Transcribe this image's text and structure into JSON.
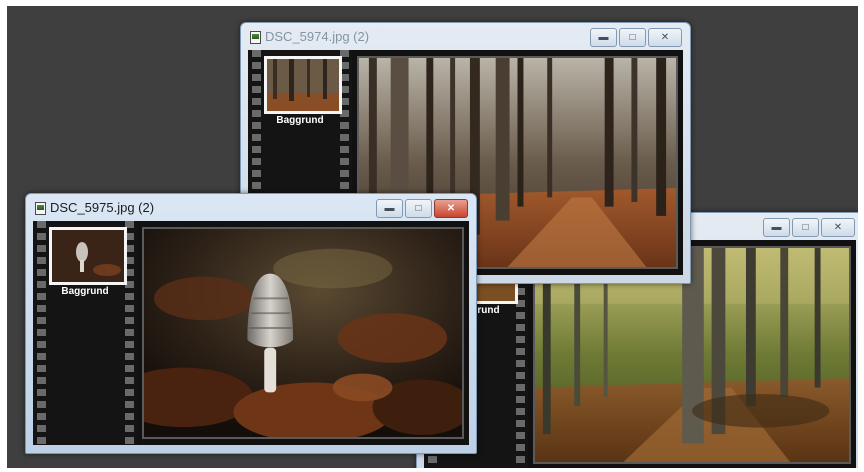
{
  "windows": {
    "back_right": {
      "title": "",
      "controls": {
        "minimize": "▬",
        "maximize": "□",
        "close": "✕"
      },
      "thumb_label": "Baggrund",
      "photo_icon": "forest-path-photo"
    },
    "top": {
      "title": "DSC_5974.jpg (2)",
      "controls": {
        "minimize": "▬",
        "maximize": "□",
        "close": "✕"
      },
      "thumb_label": "Baggrund",
      "photo_icon": "forest-trail-photo"
    },
    "front": {
      "title": "DSC_5975.jpg (2)",
      "controls": {
        "minimize": "▬",
        "maximize": "□",
        "close": "✕"
      },
      "thumb_label": "Baggrund",
      "photo_icon": "mushroom-photo"
    }
  },
  "colors": {
    "desktop": "#3f3f3f",
    "close_active": "#c8452e",
    "window_frame": "#bcd0e6"
  }
}
